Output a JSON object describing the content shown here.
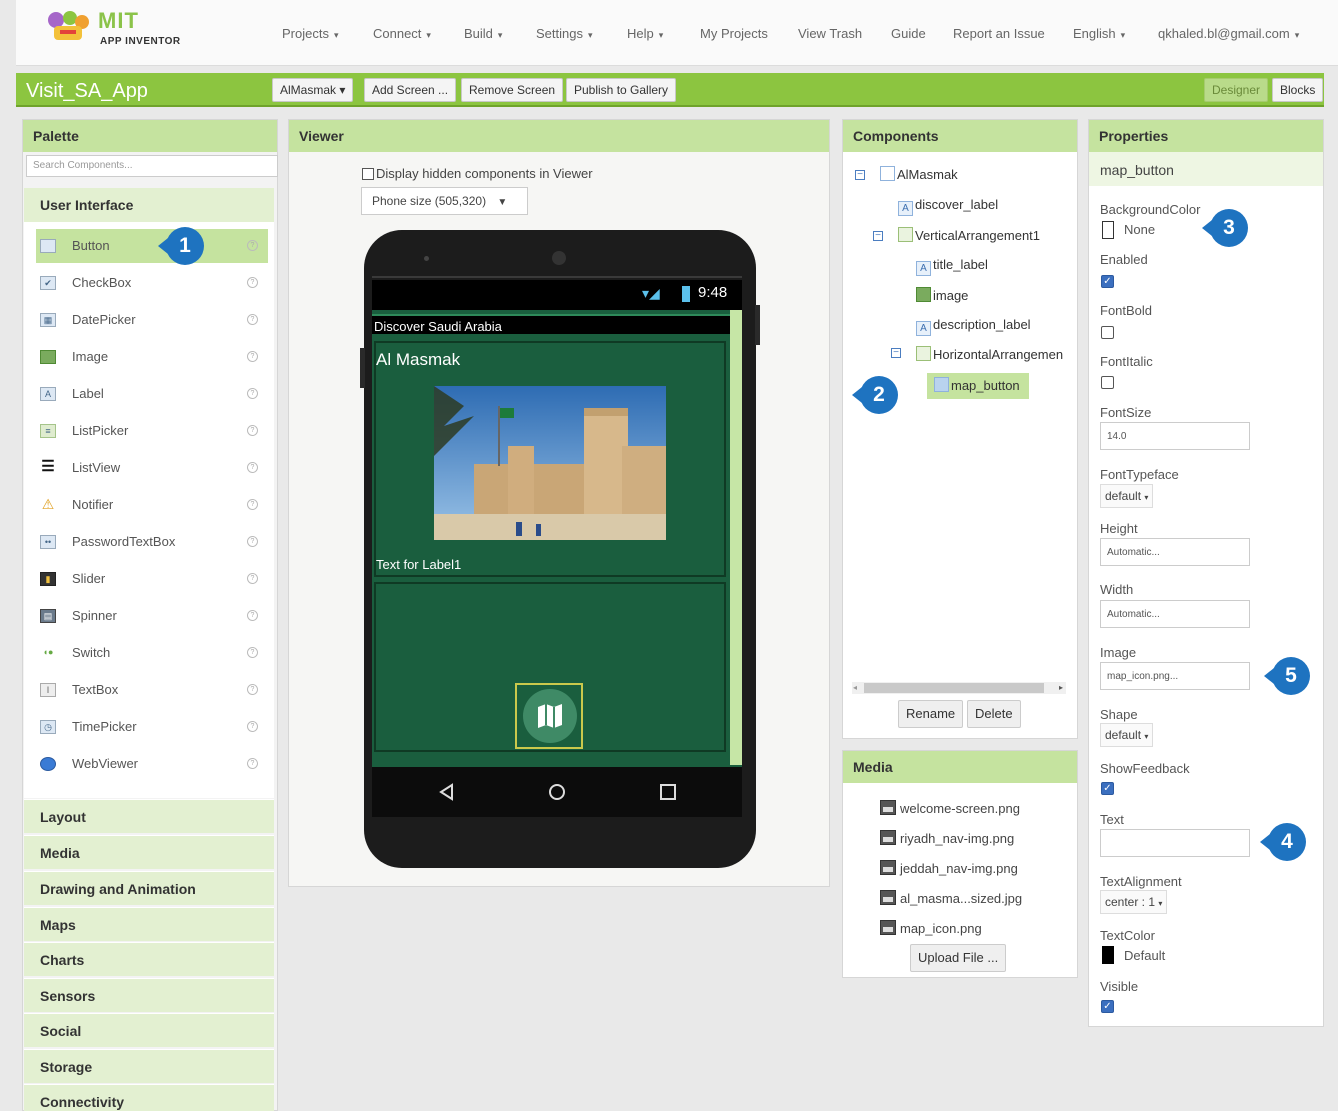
{
  "logo": {
    "title": "MIT",
    "subtitle": "APP INVENTOR"
  },
  "nav": {
    "projects": "Projects",
    "connect": "Connect",
    "build": "Build",
    "settings": "Settings",
    "help": "Help",
    "my_projects": "My Projects",
    "view_trash": "View Trash",
    "guide": "Guide",
    "report": "Report an Issue",
    "language": "English",
    "account": "qkhaled.bl@gmail.com"
  },
  "project": {
    "name": "Visit_SA_App",
    "screen_select": "AlMasmak",
    "add_screen": "Add Screen ...",
    "remove_screen": "Remove Screen",
    "publish": "Publish to Gallery",
    "designer": "Designer",
    "blocks": "Blocks"
  },
  "palette": {
    "title": "Palette",
    "search_placeholder": "Search Components...",
    "open_category": "User Interface",
    "items": [
      {
        "label": "Button",
        "icon": "button-icon"
      },
      {
        "label": "CheckBox",
        "icon": "checkbox-icon"
      },
      {
        "label": "DatePicker",
        "icon": "datepicker-icon"
      },
      {
        "label": "Image",
        "icon": "image-icon"
      },
      {
        "label": "Label",
        "icon": "label-icon"
      },
      {
        "label": "ListPicker",
        "icon": "listpicker-icon"
      },
      {
        "label": "ListView",
        "icon": "listview-icon"
      },
      {
        "label": "Notifier",
        "icon": "warning-icon"
      },
      {
        "label": "PasswordTextBox",
        "icon": "password-icon"
      },
      {
        "label": "Slider",
        "icon": "slider-icon"
      },
      {
        "label": "Spinner",
        "icon": "spinner-icon"
      },
      {
        "label": "Switch",
        "icon": "switch-icon"
      },
      {
        "label": "TextBox",
        "icon": "textbox-icon"
      },
      {
        "label": "TimePicker",
        "icon": "timepicker-icon"
      },
      {
        "label": "WebViewer",
        "icon": "globe-icon"
      }
    ],
    "help_glyph": "?",
    "categories": [
      "Layout",
      "Media",
      "Drawing and Animation",
      "Maps",
      "Charts",
      "Sensors",
      "Social",
      "Storage",
      "Connectivity"
    ]
  },
  "viewer": {
    "title": "Viewer",
    "hidden_checkbox": "Display hidden components in Viewer",
    "phone_size": "Phone size (505,320)",
    "status_time": "9:48",
    "app_title": "Discover Saudi Arabia",
    "heading": "Al Masmak",
    "label_text": "Text for Label1"
  },
  "components": {
    "title": "Components",
    "tree": [
      {
        "label": "AlMasmak"
      },
      {
        "label": "discover_label"
      },
      {
        "label": "VerticalArrangement1"
      },
      {
        "label": "title_label"
      },
      {
        "label": "image"
      },
      {
        "label": "description_label"
      },
      {
        "label": "HorizontalArrangemen"
      },
      {
        "label": "map_button"
      }
    ],
    "rename": "Rename",
    "delete": "Delete"
  },
  "media": {
    "title": "Media",
    "files": [
      "welcome-screen.png",
      "riyadh_nav-img.png",
      "jeddah_nav-img.png",
      "al_masma...sized.jpg",
      "map_icon.png"
    ],
    "upload": "Upload File ..."
  },
  "properties": {
    "title": "Properties",
    "component": "map_button",
    "background_color": {
      "label": "BackgroundColor",
      "value": "None"
    },
    "enabled": {
      "label": "Enabled",
      "checked": true
    },
    "font_bold": {
      "label": "FontBold",
      "checked": false
    },
    "font_italic": {
      "label": "FontItalic",
      "checked": false
    },
    "font_size": {
      "label": "FontSize",
      "value": "14.0"
    },
    "font_typeface": {
      "label": "FontTypeface",
      "value": "default"
    },
    "height": {
      "label": "Height",
      "value": "Automatic..."
    },
    "width": {
      "label": "Width",
      "value": "Automatic..."
    },
    "image": {
      "label": "Image",
      "value": "map_icon.png..."
    },
    "shape": {
      "label": "Shape",
      "value": "default"
    },
    "show_feedback": {
      "label": "ShowFeedback",
      "checked": true
    },
    "text": {
      "label": "Text",
      "value": ""
    },
    "text_alignment": {
      "label": "TextAlignment",
      "value": "center : 1"
    },
    "text_color": {
      "label": "TextColor",
      "value": "Default"
    },
    "visible": {
      "label": "Visible",
      "checked": true
    }
  },
  "callouts": [
    "1",
    "2",
    "3",
    "4",
    "5"
  ],
  "colors": {
    "accent_green": "#8cc540",
    "callout_blue": "#1e73c0",
    "screen_green": "#1a5e3e"
  }
}
